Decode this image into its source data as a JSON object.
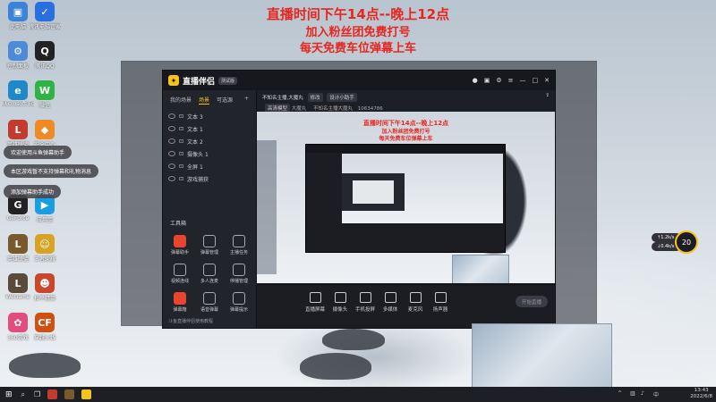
{
  "overlay": {
    "line1": "直播时间下午14点--晚上12点",
    "line2": "加入粉丝团免费打号",
    "line3": "每天免费车位弹幕上车"
  },
  "desktop_icons": [
    {
      "label": "此电脑",
      "color": "#3b83d9",
      "glyph": "▣"
    },
    {
      "label": "腾讯电脑管家",
      "color": "#2a6fe0",
      "glyph": "✓"
    },
    {
      "label": "控制面板",
      "color": "#4d8bd6",
      "glyph": "⚙"
    },
    {
      "label": "腾讯QQ",
      "color": "#222",
      "glyph": "Q"
    },
    {
      "label": "Microsoft Edge",
      "color": "#1e88c8",
      "glyph": "e"
    },
    {
      "label": "微信",
      "color": "#2fb344",
      "glyph": "W"
    },
    {
      "label": "英雄联盟",
      "color": "#c23b2e",
      "glyph": "L"
    },
    {
      "label": "安全中心",
      "color": "#f08a24",
      "glyph": "◆"
    },
    {
      "label": "GeForce",
      "color": "#222",
      "glyph": "G"
    },
    {
      "label": "应用宝",
      "color": "#1b9de2",
      "glyph": "▶"
    },
    {
      "label": "英雄联盟",
      "color": "#7a5a2c",
      "glyph": "L"
    },
    {
      "label": "王者荣耀",
      "color": "#d8a225",
      "glyph": "☺"
    },
    {
      "label": "WeGame",
      "color": "#5a4a3a",
      "glyph": "L"
    },
    {
      "label": "和平精英",
      "color": "#c9472c",
      "glyph": "☻"
    },
    {
      "label": "360游戏",
      "color": "#e34c7c",
      "glyph": "✿"
    },
    {
      "label": "穿越火线",
      "color": "#d04f12",
      "glyph": "CF"
    }
  ],
  "notifications": [
    "欢迎使用斗鱼弹幕助手",
    "本区游戏暂不支持弹幕和礼物消息",
    "添加弹幕助手成功"
  ],
  "app": {
    "name": "直播伴侣",
    "version": "测试版",
    "tabs": [
      "我的场景",
      "场景",
      "可选源"
    ],
    "sources": [
      "文本 3",
      "文本 1",
      "文本 2",
      "摄像头 1",
      "全屏 1",
      "游戏捕获"
    ],
    "tools_title": "工具箱",
    "tools": [
      "弹幕助手",
      "弹幕管理",
      "主播任务",
      "视频连线",
      "多人连麦",
      "停播管理",
      "弹幕箱",
      "语音弹幕",
      "弹幕提示"
    ],
    "footer": "斗鱼直播伴侣使用教程",
    "top_title": "不知名主播,大魔丸",
    "top_tags": [
      "修改",
      "设计小助手"
    ],
    "top_row2": [
      "高清模型",
      "大魔丸",
      "不知名主播大魔丸",
      "10634786"
    ],
    "controls": [
      "直播屏幕",
      "摄像头",
      "手机投屏",
      "多媒体",
      "麦克风",
      "扬声器"
    ],
    "start_live": "开始直播"
  },
  "inner_overlay": {
    "line1": "直播时间下午14点--晚上12点",
    "line2": "加入粉丝团免费打号",
    "line3": "每天免费车位弹幕上车"
  },
  "widget": {
    "value": "20",
    "speed_up": "↑1.2k/s",
    "speed_down": "↓0.4k/s"
  },
  "taskbar": {
    "time": "13:43",
    "date": "2022/6/8"
  }
}
